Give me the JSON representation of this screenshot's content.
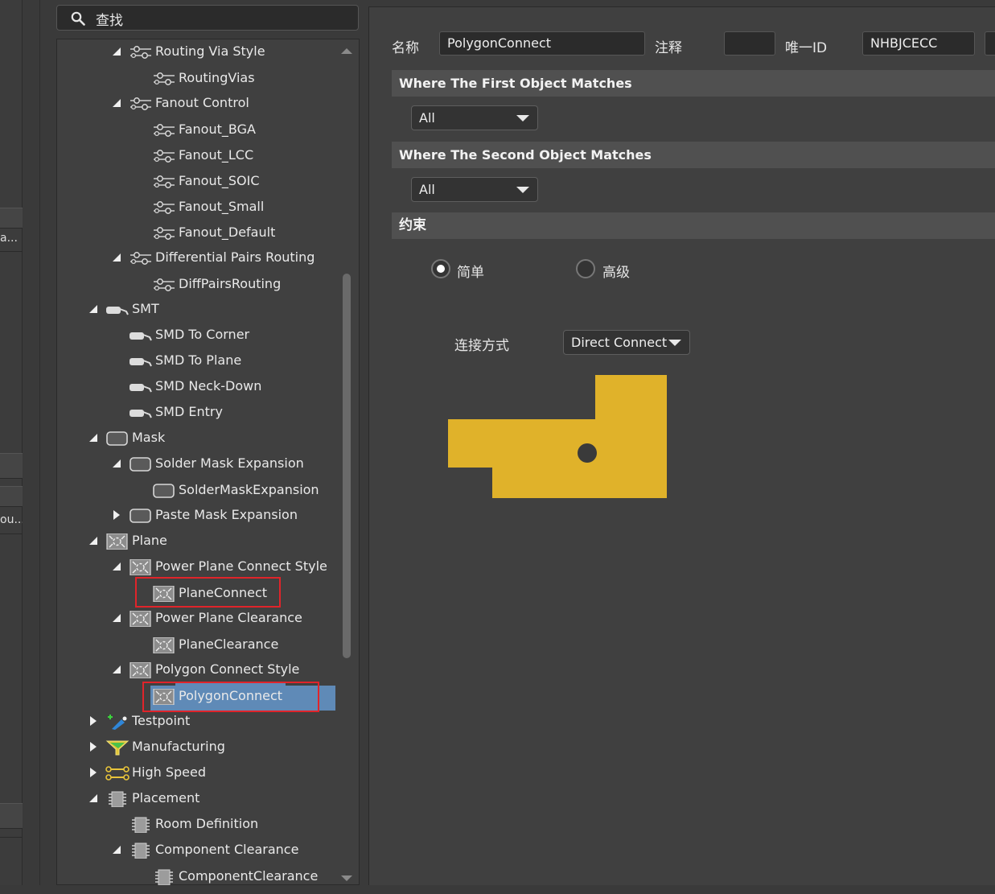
{
  "left_strip": {
    "item_a": "a...",
    "item_b": "ou..."
  },
  "search": {
    "label": "查找"
  },
  "tree": {
    "items": [
      {
        "label": "Routing Via Style",
        "icon": "rule-connector-icon"
      },
      {
        "label": "RoutingVias",
        "icon": "rule-connector-icon"
      },
      {
        "label": "Fanout Control",
        "icon": "rule-connector-icon"
      },
      {
        "label": "Fanout_BGA",
        "icon": "rule-connector-icon"
      },
      {
        "label": "Fanout_LCC",
        "icon": "rule-connector-icon"
      },
      {
        "label": "Fanout_SOIC",
        "icon": "rule-connector-icon"
      },
      {
        "label": "Fanout_Small",
        "icon": "rule-connector-icon"
      },
      {
        "label": "Fanout_Default",
        "icon": "rule-connector-icon"
      },
      {
        "label": "Differential Pairs Routing",
        "icon": "rule-connector-icon"
      },
      {
        "label": "DiffPairsRouting",
        "icon": "rule-connector-icon"
      },
      {
        "label": "SMT",
        "icon": "smt-pad-icon"
      },
      {
        "label": "SMD To Corner",
        "icon": "smt-pad-icon"
      },
      {
        "label": "SMD To Plane",
        "icon": "smt-pad-icon"
      },
      {
        "label": "SMD Neck-Down",
        "icon": "smt-pad-icon"
      },
      {
        "label": "SMD Entry",
        "icon": "smt-pad-icon"
      },
      {
        "label": "Mask",
        "icon": "mask-icon"
      },
      {
        "label": "Solder Mask Expansion",
        "icon": "mask-icon"
      },
      {
        "label": "SolderMaskExpansion",
        "icon": "mask-icon"
      },
      {
        "label": "Paste Mask Expansion",
        "icon": "mask-icon"
      },
      {
        "label": "Plane",
        "icon": "plane-icon"
      },
      {
        "label": "Power Plane Connect Style",
        "icon": "plane-icon"
      },
      {
        "label": "PlaneConnect",
        "icon": "plane-icon"
      },
      {
        "label": "Power Plane Clearance",
        "icon": "plane-icon"
      },
      {
        "label": "PlaneClearance",
        "icon": "plane-icon"
      },
      {
        "label": "Polygon Connect Style",
        "icon": "plane-icon"
      },
      {
        "label": "PolygonConnect",
        "icon": "plane-icon"
      },
      {
        "label": "Testpoint",
        "icon": "testpoint-icon"
      },
      {
        "label": "Manufacturing",
        "icon": "manufacturing-icon"
      },
      {
        "label": "High Speed",
        "icon": "high-speed-icon"
      },
      {
        "label": "Placement",
        "icon": "chip-icon"
      },
      {
        "label": "Room Definition",
        "icon": "chip-icon"
      },
      {
        "label": "Component Clearance",
        "icon": "chip-icon"
      },
      {
        "label": "ComponentClearance",
        "icon": "chip-icon"
      }
    ]
  },
  "form": {
    "name_label": "名称",
    "name_value": "PolygonConnect",
    "comment_label": "注释",
    "comment_value": "",
    "uid_label": "唯一ID",
    "uid_value": "NHBJCECC"
  },
  "first_match": {
    "title": "Where The First Object Matches",
    "value": "All"
  },
  "second_match": {
    "title": "Where The Second Object Matches",
    "value": "All"
  },
  "constraints": {
    "title": "约束",
    "simple_label": "简单",
    "advanced_label": "高级",
    "selected": "simple",
    "connect_label": "连接方式",
    "connect_value": "Direct Connect"
  },
  "colors": {
    "selection": "#5f8ab7",
    "highlight_box": "#e0242a",
    "copper": "#e0b22a"
  }
}
